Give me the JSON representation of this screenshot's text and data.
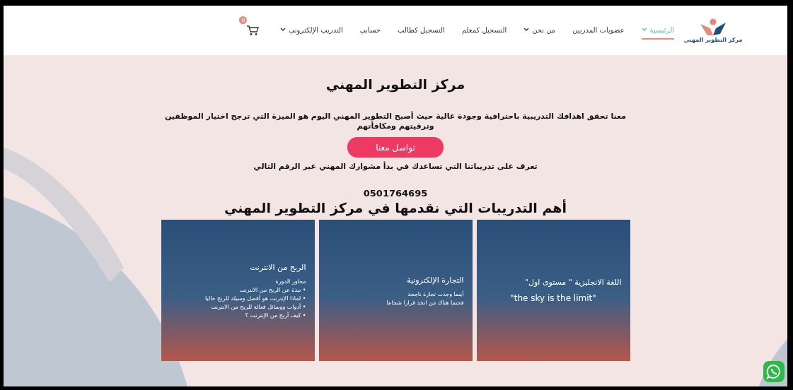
{
  "nav": {
    "logo_text": "مركز التطوير المهني",
    "items": [
      {
        "label": "الرئيسية",
        "selected": true,
        "has_dropdown": true
      },
      {
        "label": "عضويات المدربين",
        "selected": false,
        "has_dropdown": false
      },
      {
        "label": "من نحن",
        "selected": false,
        "has_dropdown": true
      },
      {
        "label": "التسجيل كمعلم",
        "selected": false,
        "has_dropdown": false
      },
      {
        "label": "التسجيل كطالب",
        "selected": false,
        "has_dropdown": false
      },
      {
        "label": "حسابي",
        "selected": false,
        "has_dropdown": false
      },
      {
        "label": "التدريب الإلكتروني",
        "selected": false,
        "has_dropdown": true
      }
    ],
    "cart_count": "0"
  },
  "hero": {
    "title": "مركز التطوير المهني",
    "text": "معنا تحقق اهدافك التدريبية باحترافية وجودة عالية حيث أصبح التطوير المهني اليوم هو الميزة التي ترجح اختيار الموظفين وترقيتهم ومكافأتهم",
    "button": "تواصل معنا",
    "note": "تعرف على تدريباتنا التي تساعدك في بدأ مشوارك المهني عبر الرقم التالي",
    "phone": "0501764695"
  },
  "courses": {
    "heading": "أهم التدريبات التي نقدمها في مركز التطوير المهني",
    "items": [
      {
        "title": "اللغة الانجليزية \" مستوى اول\"",
        "lines": [
          "\"the sky is the limit\""
        ]
      },
      {
        "title": "التجارة الإلكترونية",
        "lines": [
          "أينما وجدت تجارة ناجحة",
          "فحتما هناك من اتخذ قرارا شجاعا"
        ]
      },
      {
        "title": "الربح من الانترنت",
        "lines": [
          "محاور الدورة",
          "• نبذة عن الربح من الانترنت",
          "• لماذا الإنترنت هو أفضل وسيلة للربح حاليا",
          "• أدوات ووسائل فعالة للربح من الانترنت",
          "• كيف أربح من الإنترنت ؟"
        ]
      }
    ]
  }
}
